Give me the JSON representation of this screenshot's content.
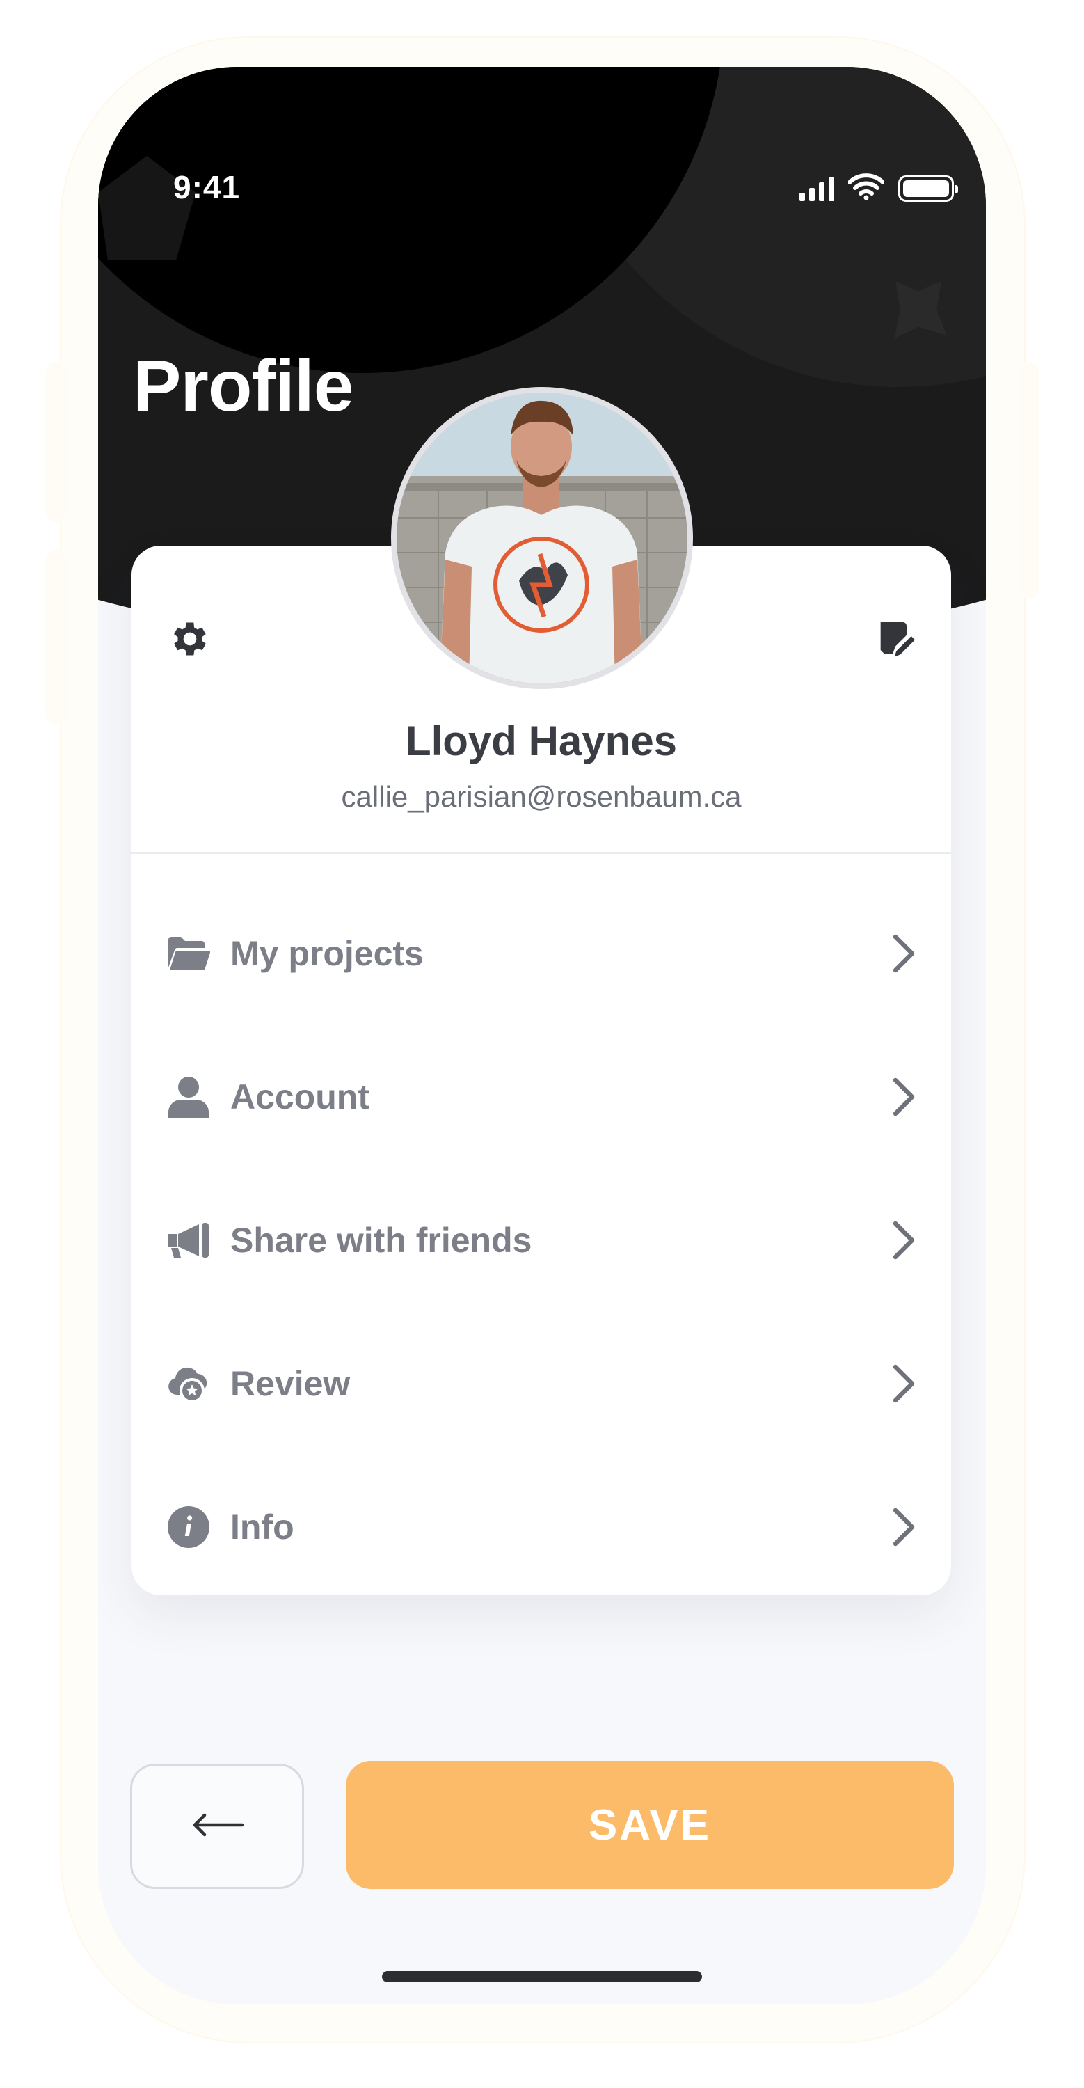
{
  "status_bar": {
    "time": "9:41",
    "icons": [
      "cellular-signal-icon",
      "wifi-icon",
      "battery-icon"
    ]
  },
  "header": {
    "title": "Profile"
  },
  "profile": {
    "name": "Lloyd Haynes",
    "email": "callie_parisian@rosenbaum.ca",
    "avatar_icon": "user-avatar-photo",
    "settings_icon": "gear-icon",
    "edit_icon": "edit-note-icon"
  },
  "menu": {
    "items": [
      {
        "label": "My projects",
        "icon": "folder-open-icon"
      },
      {
        "label": "Account",
        "icon": "user-icon"
      },
      {
        "label": "Share with friends",
        "icon": "megaphone-icon"
      },
      {
        "label": "Review",
        "icon": "cloud-star-icon"
      },
      {
        "label": "Info",
        "icon": "info-circle-icon"
      }
    ],
    "chevron_icon": "chevron-right-icon"
  },
  "actions": {
    "back_icon": "arrow-left-icon",
    "save_label": "SAVE"
  },
  "colors": {
    "header_dark": "#1b1b1c",
    "accent": "#fbbb68",
    "text_dark": "#3b3d44",
    "text_muted": "#7c7f87",
    "background": "#f7f8fb"
  }
}
